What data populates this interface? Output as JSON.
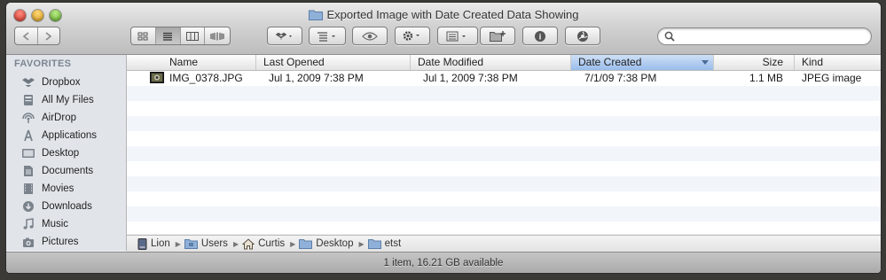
{
  "window": {
    "title": "Exported Image with Date Created Data Showing"
  },
  "toolbar": {
    "search_placeholder": ""
  },
  "sidebar": {
    "heading": "FAVORITES",
    "items": [
      {
        "label": "Dropbox",
        "icon": "dropbox-icon"
      },
      {
        "label": "All My Files",
        "icon": "all-files-icon"
      },
      {
        "label": "AirDrop",
        "icon": "airdrop-icon"
      },
      {
        "label": "Applications",
        "icon": "applications-icon"
      },
      {
        "label": "Desktop",
        "icon": "desktop-icon"
      },
      {
        "label": "Documents",
        "icon": "documents-icon"
      },
      {
        "label": "Movies",
        "icon": "movies-icon"
      },
      {
        "label": "Downloads",
        "icon": "downloads-icon"
      },
      {
        "label": "Music",
        "icon": "music-icon"
      },
      {
        "label": "Pictures",
        "icon": "pictures-icon"
      }
    ]
  },
  "columns": {
    "name": "Name",
    "last_opened": "Last Opened",
    "date_modified": "Date Modified",
    "date_created": "Date Created",
    "size": "Size",
    "kind": "Kind"
  },
  "files": [
    {
      "name": "IMG_0378.JPG",
      "last_opened": "Jul 1, 2009 7:38 PM",
      "date_modified": "Jul 1, 2009 7:38 PM",
      "date_created": "7/1/09 7:38 PM",
      "size": "1.1 MB",
      "kind": "JPEG image"
    }
  ],
  "path": [
    {
      "label": "Lion",
      "icon": "hard-drive-icon"
    },
    {
      "label": "Users",
      "icon": "folder-icon"
    },
    {
      "label": "Curtis",
      "icon": "home-icon"
    },
    {
      "label": "Desktop",
      "icon": "folder-icon"
    },
    {
      "label": "etst",
      "icon": "folder-icon"
    }
  ],
  "status": {
    "text": "1 item, 16.21 GB available"
  },
  "colors": {
    "sidebar_bg": "#e1e5ea",
    "sorted_column": "#99bdec",
    "folder": "#8fb0d8"
  }
}
